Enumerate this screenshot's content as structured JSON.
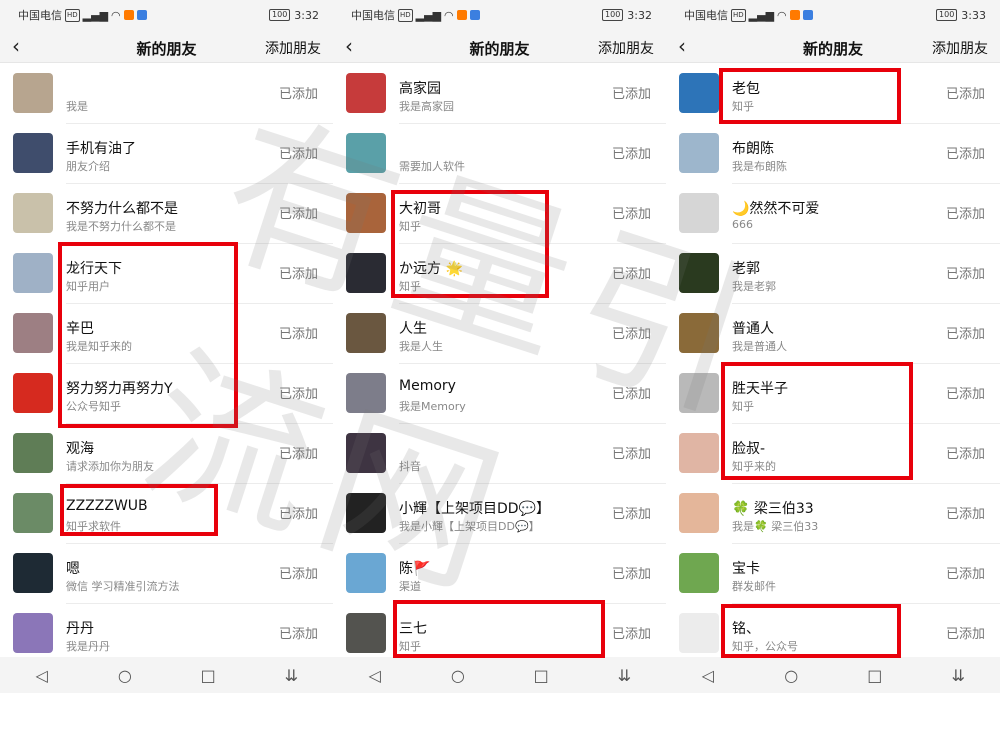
{
  "status": {
    "carrier": "中国电信",
    "hd": "HD",
    "battery": "100"
  },
  "screens": [
    {
      "time": "3:32",
      "title": "新的朋友",
      "add": "添加朋友",
      "rows": [
        {
          "name": "",
          "sub": "我是",
          "status": "已添加",
          "color": "#b7a58f"
        },
        {
          "name": "手机有油了",
          "sub": "朋友介绍",
          "status": "已添加",
          "color": "#3f4d6c"
        },
        {
          "name": "不努力什么都不是",
          "sub": "我是不努力什么都不是",
          "status": "已添加",
          "color": "#c9c1aa"
        },
        {
          "name": "龙行天下",
          "sub": "知乎用户",
          "status": "已添加",
          "color": "#9fb1c6"
        },
        {
          "name": "辛巴",
          "sub": "我是知乎来的",
          "status": "已添加",
          "color": "#9d7f83"
        },
        {
          "name": "努力努力再努力Y",
          "sub": "公众号知乎",
          "status": "已添加",
          "color": "#d62a1f"
        },
        {
          "name": "观海",
          "sub": "请求添加你为朋友",
          "status": "已添加",
          "color": "#5f7d56"
        },
        {
          "name": "ZZZZZWUB",
          "sub": "知乎求软件",
          "status": "已添加",
          "color": "#6b8b66"
        },
        {
          "name": "嗯",
          "sub": "微信 学习精准引流方法",
          "status": "已添加",
          "color": "#1e2a34"
        },
        {
          "name": "丹丹",
          "sub": "我是丹丹",
          "status": "已添加",
          "color": "#8b76b8"
        }
      ]
    },
    {
      "time": "3:32",
      "title": "新的朋友",
      "add": "添加朋友",
      "rows": [
        {
          "name": "高家园",
          "sub": "我是高家园",
          "status": "已添加",
          "color": "#c63b3b"
        },
        {
          "name": "",
          "sub": "需要加人软件",
          "status": "已添加",
          "color": "#5aa0a8"
        },
        {
          "name": "大初哥",
          "sub": "知乎",
          "status": "已添加",
          "color": "#a9643b"
        },
        {
          "name": "か远方 🌟",
          "sub": "知乎",
          "status": "已添加",
          "color": "#2a2b33"
        },
        {
          "name": "人生",
          "sub": "我是人生",
          "status": "已添加",
          "color": "#6a5740"
        },
        {
          "name": "Memory",
          "sub": "我是Memory",
          "status": "已添加",
          "color": "#7d7d8a"
        },
        {
          "name": "",
          "sub": "抖音",
          "status": "已添加",
          "color": "#3e3442"
        },
        {
          "name": "小輝【上架项目DD💬】",
          "sub": "我是小輝【上架项目DD💬】",
          "status": "已添加",
          "color": "#222222"
        },
        {
          "name": "陈🚩",
          "sub": "渠道",
          "status": "已添加",
          "color": "#6aa7d3"
        },
        {
          "name": "三七",
          "sub": "知乎",
          "status": "已添加",
          "color": "#53534f"
        }
      ]
    },
    {
      "time": "3:33",
      "title": "新的朋友",
      "add": "添加朋友",
      "rows": [
        {
          "name": "老包",
          "sub": "知乎",
          "status": "已添加",
          "color": "#2d74b8"
        },
        {
          "name": "布朗陈",
          "sub": "我是布朗陈",
          "status": "已添加",
          "color": "#9db6cc"
        },
        {
          "name": "🌙然然不可爱",
          "sub": "666",
          "status": "已添加",
          "color": "#d6d6d6"
        },
        {
          "name": "老郭",
          "sub": "我是老郭",
          "status": "已添加",
          "color": "#2a3a1f"
        },
        {
          "name": "普通人",
          "sub": "我是普通人",
          "status": "已添加",
          "color": "#8a6a39"
        },
        {
          "name": "胜天半子",
          "sub": "知乎",
          "status": "已添加",
          "color": "#b9b9b9"
        },
        {
          "name": "脸叔-",
          "sub": "知乎来的",
          "status": "已添加",
          "color": "#e0b5a4"
        },
        {
          "name": "🍀 梁三伯33",
          "sub": "我是🍀 梁三伯33",
          "status": "已添加",
          "color": "#e4b69a"
        },
        {
          "name": "宝卡",
          "sub": "群发邮件",
          "status": "已添加",
          "color": "#6fa750"
        },
        {
          "name": "铭、",
          "sub": "知乎，公众号",
          "status": "已添加",
          "color": "#ececec"
        }
      ]
    }
  ],
  "nav": {
    "back": "◁",
    "home": "○",
    "recent": "□",
    "menu": "⇊"
  },
  "watermark": "有量引流网"
}
